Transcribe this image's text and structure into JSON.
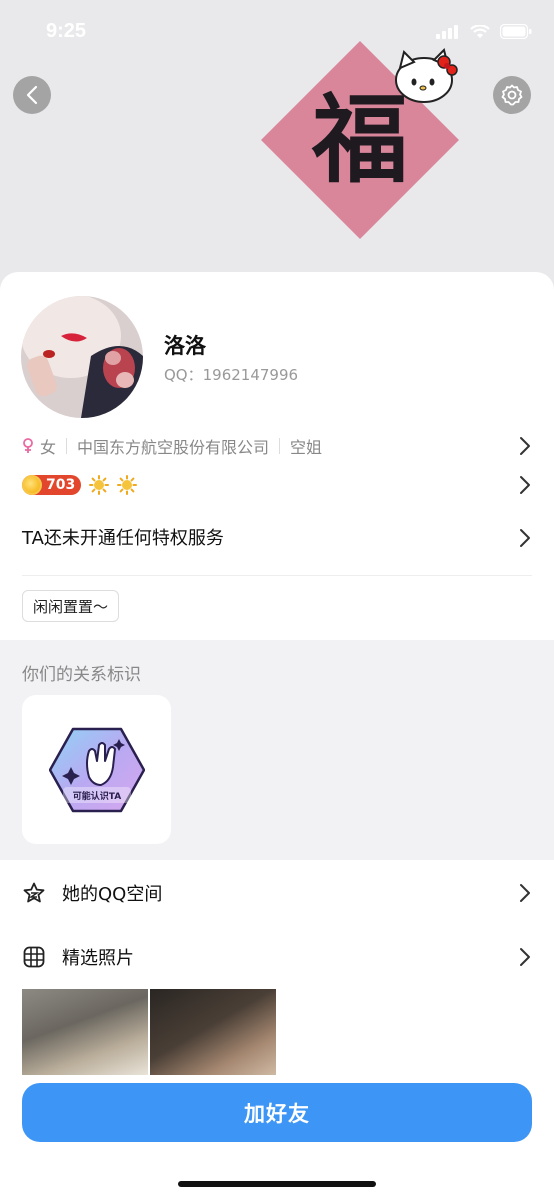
{
  "status_bar": {
    "time": "9:25"
  },
  "cover": {
    "poster_char": "福"
  },
  "profile": {
    "nickname": "洛洛",
    "qq_label": "QQ：",
    "qq_number": "1962147996",
    "gender_icon": "female-icon",
    "gender": "女",
    "company": "中国东方航空股份有限公司",
    "occupation": "空姐",
    "level": "703",
    "privilege_text": "TA还未开通任何特权服务",
    "tag": "闲闲置置～"
  },
  "relation": {
    "title": "你们的关系标识",
    "badge_label": "可能认识TA"
  },
  "menu": {
    "qzone": "她的QQ空间",
    "photos": "精选照片"
  },
  "actions": {
    "add_friend": "加好友"
  },
  "colors": {
    "accent_blue": "#3d95f5",
    "level_red": "#e2472d",
    "gender_pink": "#e86aa2",
    "poster_pink": "#d9869b"
  }
}
